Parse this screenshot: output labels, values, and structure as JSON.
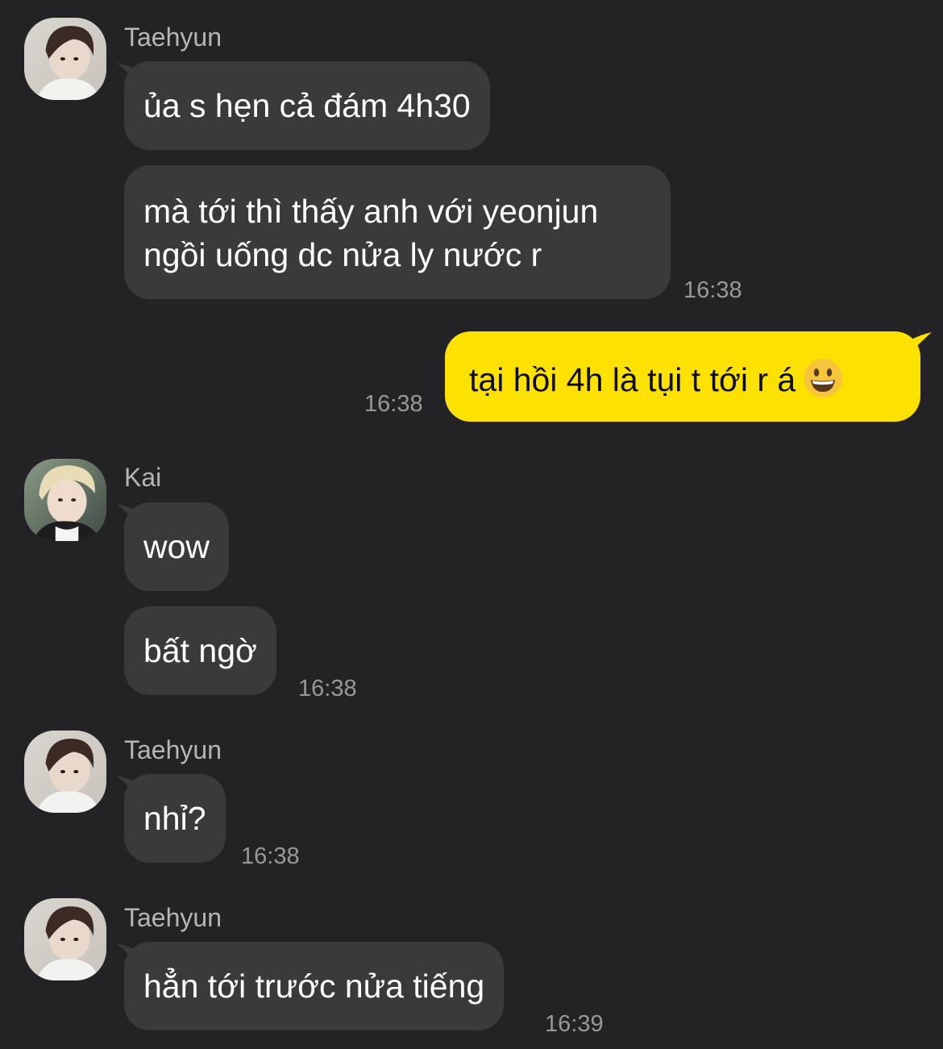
{
  "messages": [
    {
      "sender": "Taehyun",
      "avatar": "taehyun-avatar",
      "lines": [
        "ủa s hẹn cả đám 4h30"
      ]
    },
    {
      "sender": "Taehyun",
      "lines": [
        "mà tới thì thấy anh với yeonjun",
        "ngồi uống dc nửa ly nước r"
      ],
      "time": "16:38"
    },
    {
      "sender": "me",
      "text": "tại hồi 4h là tụi t tới r á",
      "emoji": "grinning-face-emoji",
      "time": "16:38"
    },
    {
      "sender": "Kai",
      "avatar": "kai-avatar",
      "lines": [
        "wow"
      ]
    },
    {
      "sender": "Kai",
      "lines": [
        "bất ngờ"
      ],
      "time": "16:38"
    },
    {
      "sender": "Taehyun",
      "avatar": "taehyun-avatar",
      "lines": [
        "nhỉ?"
      ],
      "time": "16:38"
    },
    {
      "sender": "Taehyun",
      "avatar": "taehyun-avatar",
      "lines": [
        "hẳn tới trước nửa tiếng"
      ],
      "time": "16:39"
    }
  ],
  "colors": {
    "background": "#232325",
    "incoming_bubble": "#3a3a3d",
    "outgoing_bubble": "#fde100",
    "timestamp": "#98989c",
    "sender_name": "#b5b5b8"
  }
}
